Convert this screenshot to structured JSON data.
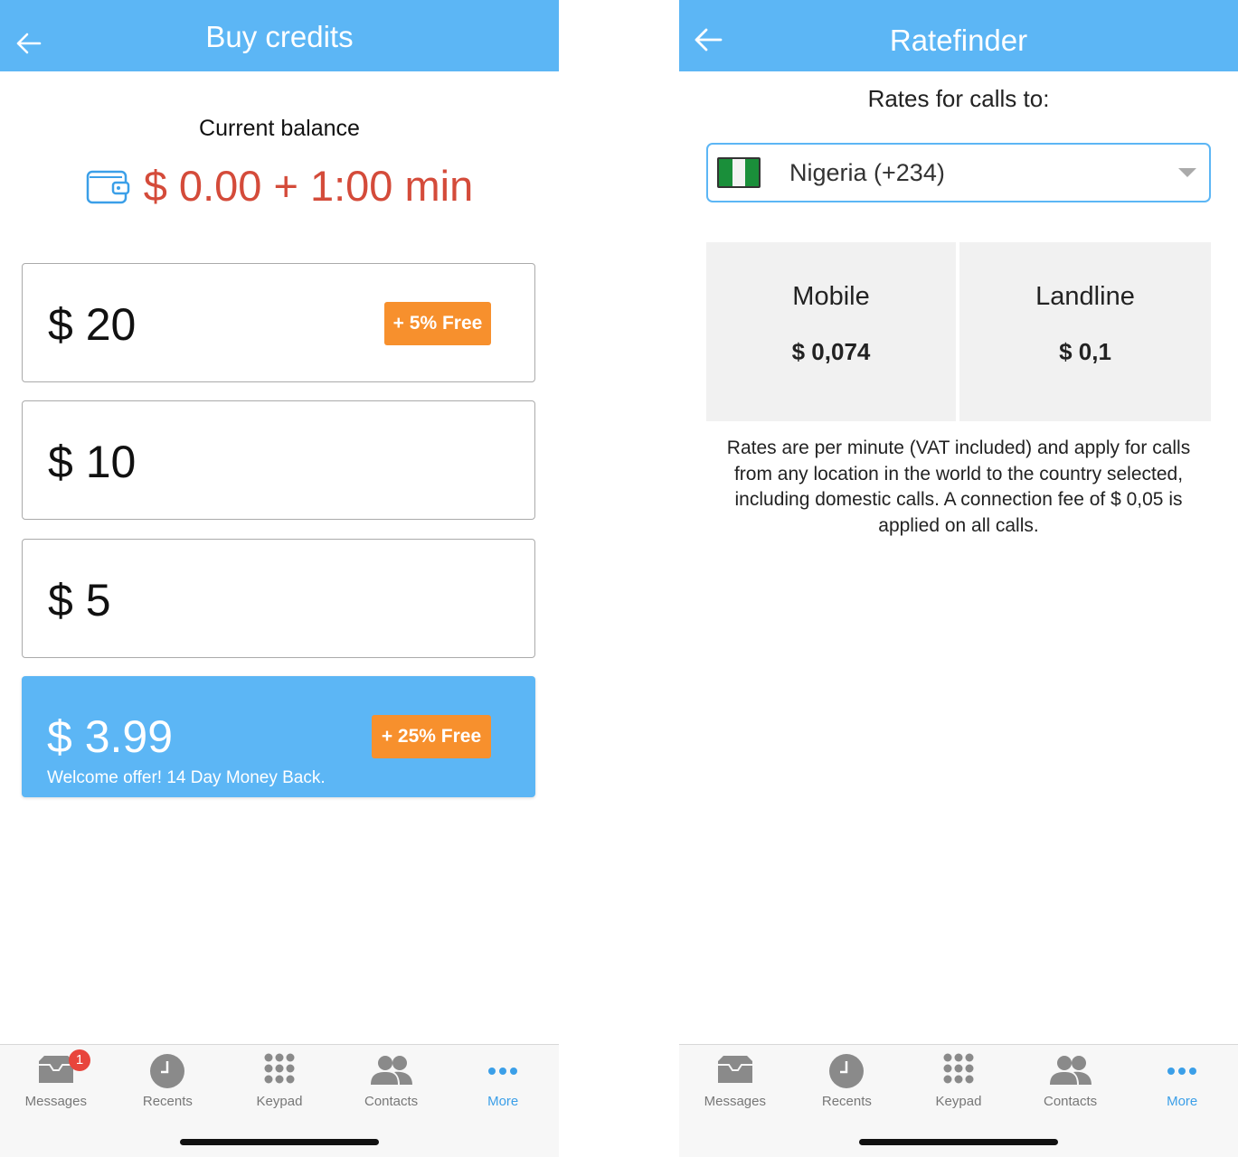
{
  "left_screen": {
    "header": {
      "title": "Buy credits",
      "back_icon": "arrow-left-icon"
    },
    "balance": {
      "label": "Current balance",
      "value": "$ 0.00 + 1:00 min",
      "icon": "wallet-icon",
      "color": "#d44b3a"
    },
    "options": [
      {
        "amount": "$ 20",
        "badge": "+ 5% Free"
      },
      {
        "amount": "$ 10"
      },
      {
        "amount": "$ 5"
      },
      {
        "amount": "$ 3.99",
        "badge": "+ 25% Free",
        "subtitle": "Welcome offer! 14 Day Money Back."
      }
    ]
  },
  "right_screen": {
    "header": {
      "title": "Ratefinder",
      "back_icon": "arrow-left-icon"
    },
    "rates_label": "Rates for calls to:",
    "country": {
      "name": "Nigeria (+234)",
      "flag": "nigeria-flag-icon"
    },
    "rates": [
      {
        "type": "Mobile",
        "price": "$ 0,074"
      },
      {
        "type": "Landline",
        "price": "$ 0,1"
      }
    ],
    "note": "Rates are per minute (VAT included) and apply for calls from any location in the world to the country selected, including domestic calls. A connection fee of $ 0,05 is applied on all calls."
  },
  "tab_bar": {
    "tabs": [
      {
        "label": "Messages",
        "icon": "inbox-icon",
        "badge": "1"
      },
      {
        "label": "Recents",
        "icon": "clock-icon"
      },
      {
        "label": "Keypad",
        "icon": "keypad-icon"
      },
      {
        "label": "Contacts",
        "icon": "contacts-icon"
      },
      {
        "label": "More",
        "icon": "more-dots-icon",
        "active": true
      }
    ]
  },
  "colors": {
    "header": "#5cb6f5",
    "badge": "#f7902d",
    "active_tab": "#3b9fe8",
    "notification": "#e8453c"
  }
}
